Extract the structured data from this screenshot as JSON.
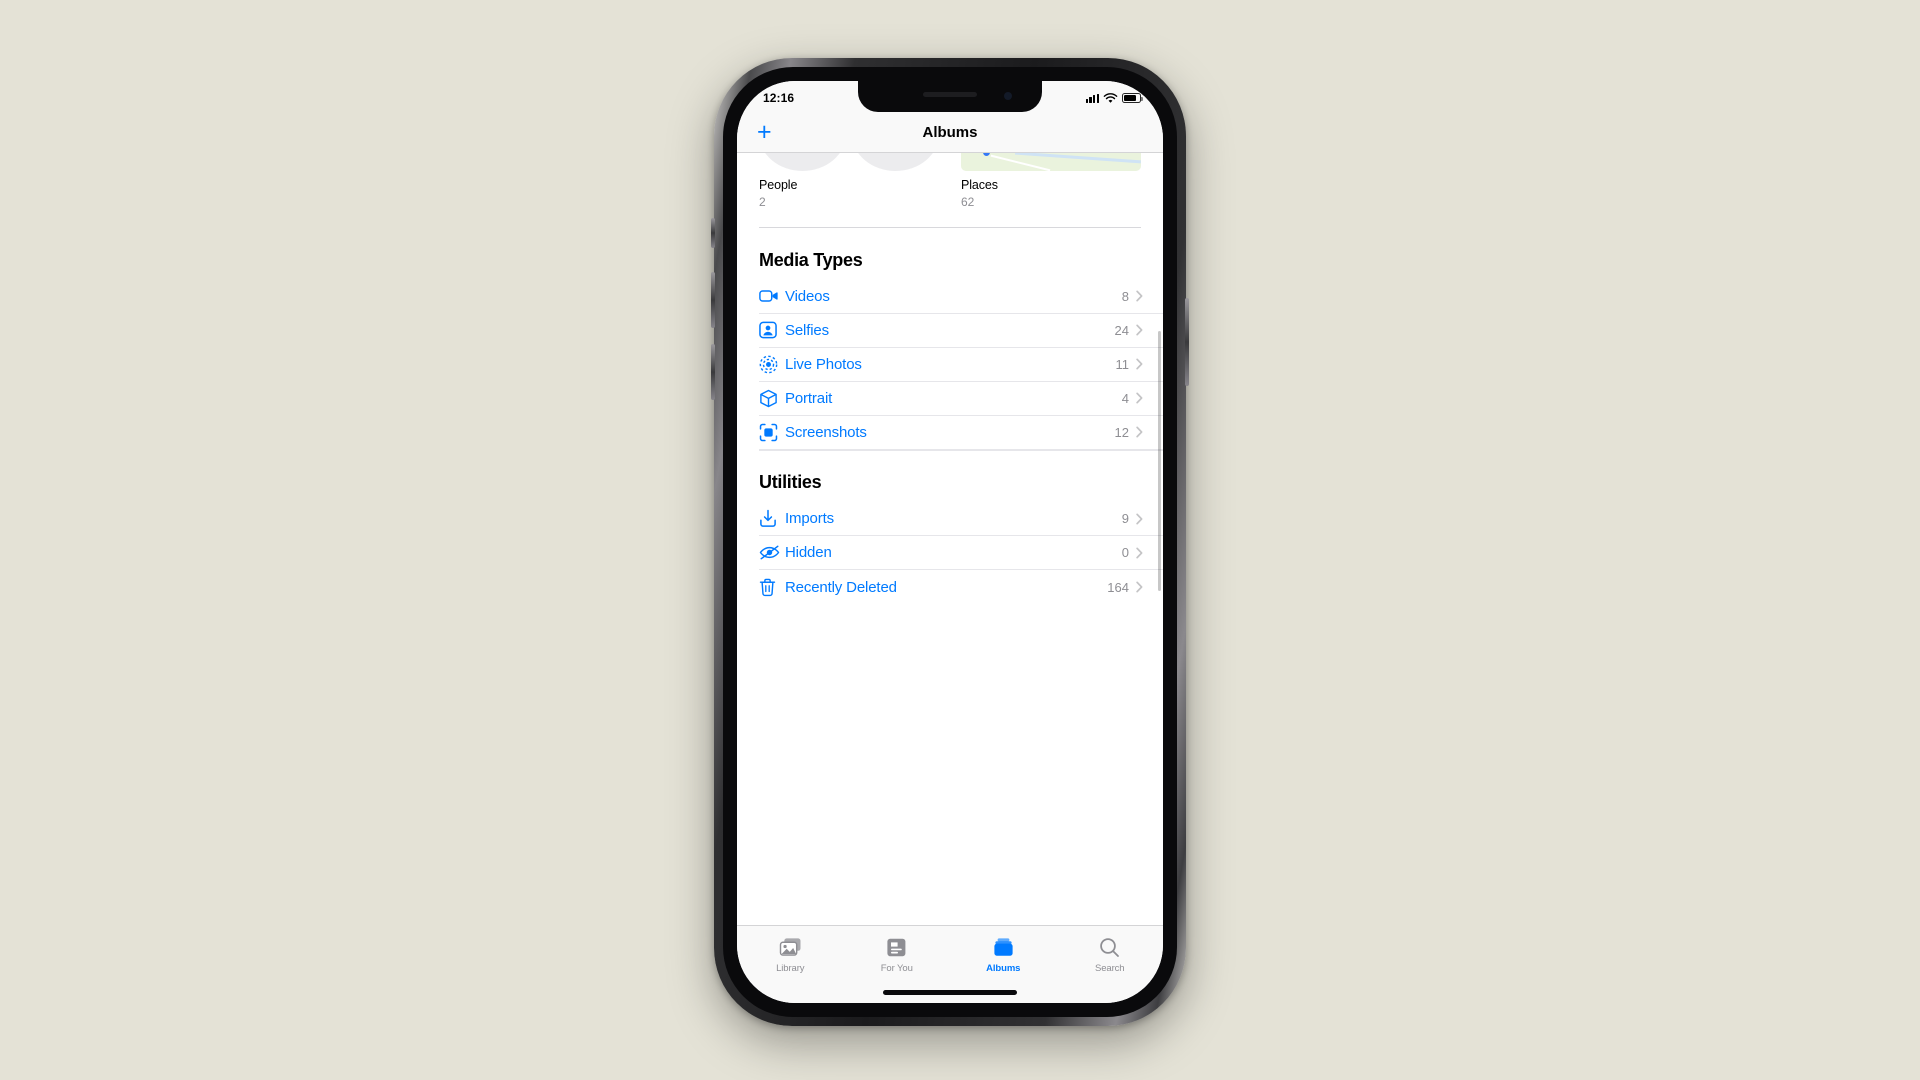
{
  "background_color": "#e4e2d6",
  "accent_color": "#007aff",
  "statusbar": {
    "time": "12:16",
    "signal_icon": "cellular-signal-icon",
    "wifi_icon": "wifi-icon",
    "battery_icon": "battery-icon"
  },
  "navbar": {
    "add_label": "+",
    "title": "Albums"
  },
  "collections": [
    {
      "name": "People",
      "count": "2",
      "thumb": "people-avatars-thumbnail"
    },
    {
      "name": "Places",
      "count": "62",
      "thumb": "map-thumbnail"
    }
  ],
  "sections": [
    {
      "title": "Media Types",
      "rows": [
        {
          "label": "Videos",
          "count": "8",
          "icon": "video-camera-icon"
        },
        {
          "label": "Selfies",
          "count": "24",
          "icon": "selfie-person-icon"
        },
        {
          "label": "Live Photos",
          "count": "11",
          "icon": "live-photos-icon"
        },
        {
          "label": "Portrait",
          "count": "4",
          "icon": "cube-portrait-icon"
        },
        {
          "label": "Screenshots",
          "count": "12",
          "icon": "screenshot-viewfinder-icon"
        }
      ]
    },
    {
      "title": "Utilities",
      "rows": [
        {
          "label": "Imports",
          "count": "9",
          "icon": "import-download-icon"
        },
        {
          "label": "Hidden",
          "count": "0",
          "icon": "eye-slash-icon"
        },
        {
          "label": "Recently Deleted",
          "count": "164",
          "icon": "trash-icon"
        }
      ]
    }
  ],
  "tabbar": {
    "tabs": [
      {
        "label": "Library",
        "icon": "photos-stack-icon",
        "active": false
      },
      {
        "label": "For You",
        "icon": "for-you-card-icon",
        "active": false
      },
      {
        "label": "Albums",
        "icon": "albums-book-icon",
        "active": true
      },
      {
        "label": "Search",
        "icon": "search-magnifier-icon",
        "active": false
      }
    ]
  }
}
